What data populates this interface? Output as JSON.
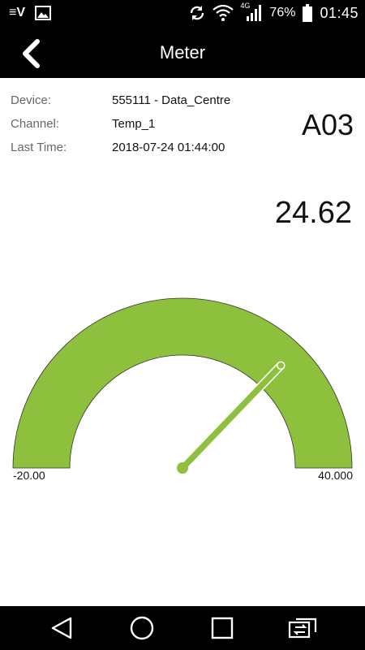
{
  "status_bar": {
    "carrier_glyph": "≡V",
    "network_type": "4G",
    "battery_percent": "76%",
    "time": "01:45",
    "icons": [
      "ev-app-icon",
      "image-icon",
      "sync-icon",
      "wifi-icon",
      "signal-icon",
      "battery-icon"
    ]
  },
  "app_bar": {
    "title": "Meter",
    "back_icon": "back-chevron-icon"
  },
  "info": {
    "rows": [
      {
        "label": "Device:",
        "value": "555111 - Data_Centre"
      },
      {
        "label": "Channel:",
        "value": "Temp_1"
      },
      {
        "label": "Last Time:",
        "value": "2018-07-24 01:44:00"
      }
    ]
  },
  "meter": {
    "code": "A03",
    "value": "24.62",
    "min_label": "-20.00",
    "max_label": "40.000",
    "min": -20,
    "max": 40,
    "reading": 24.62,
    "gauge_color": "#8DC03C"
  },
  "nav_bar": {
    "icons": [
      "back-triangle-icon",
      "home-circle-icon",
      "recents-square-icon",
      "switch-app-icon"
    ]
  }
}
